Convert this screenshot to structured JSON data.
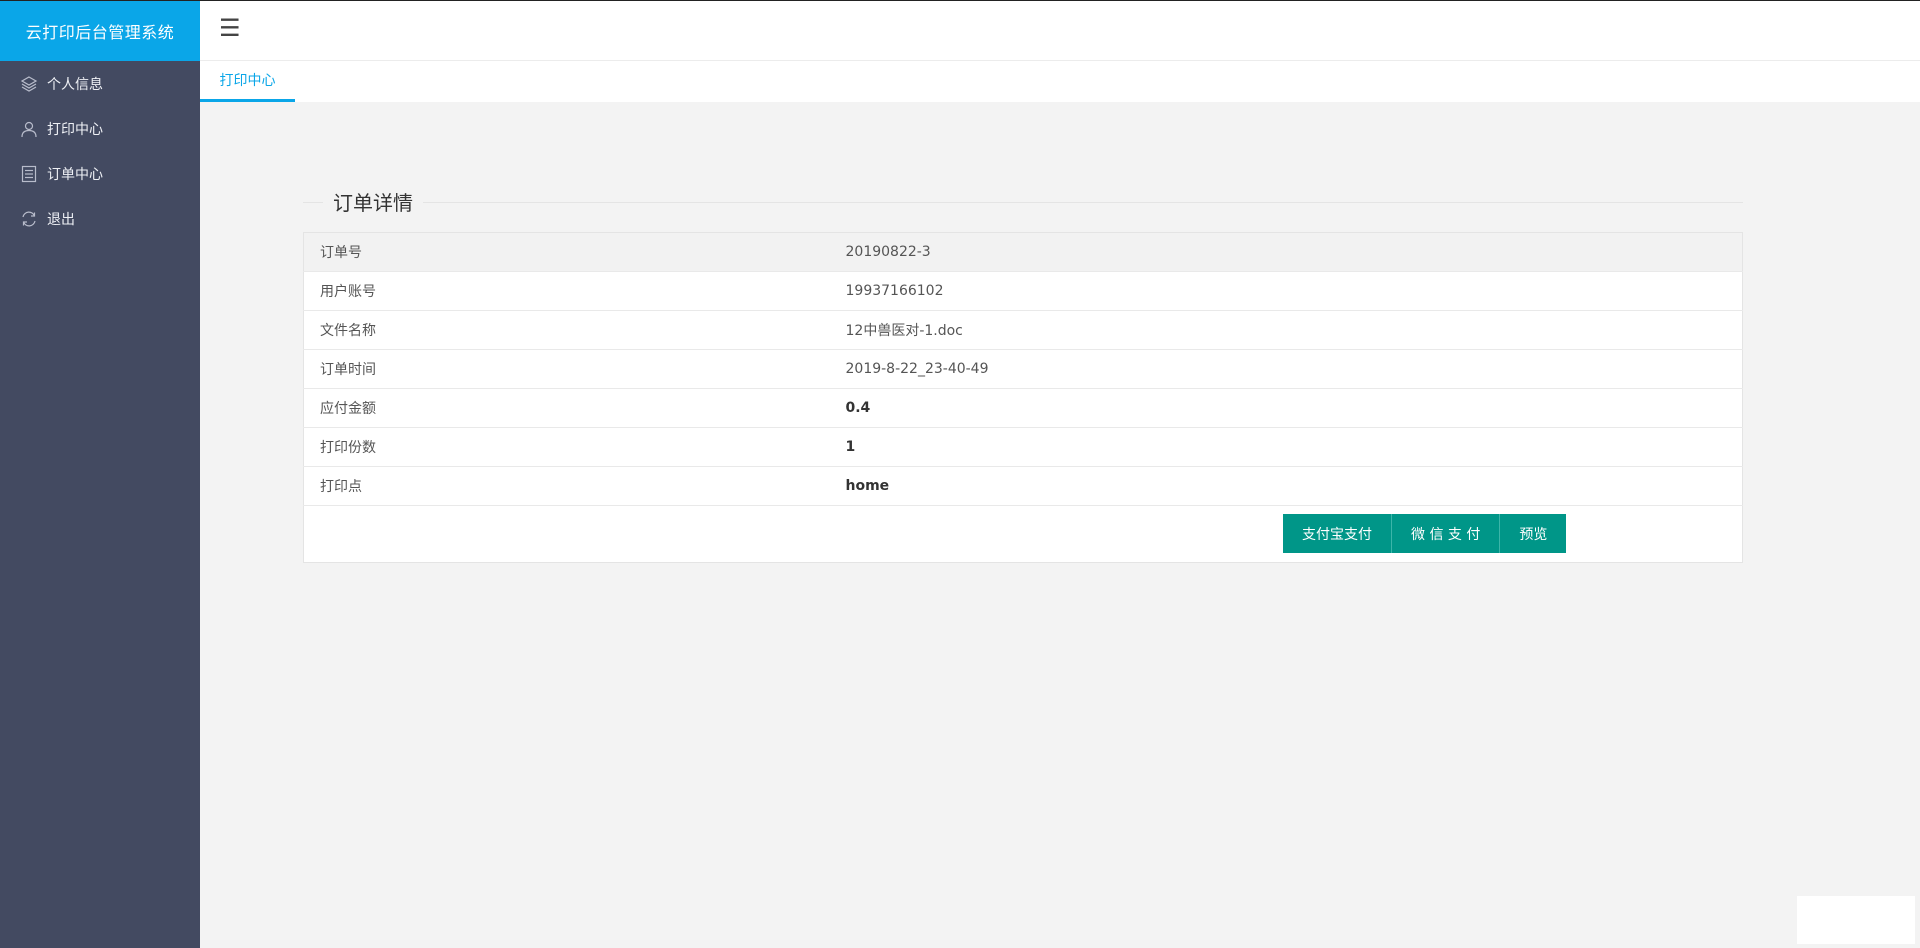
{
  "app": {
    "title": "云打印后台管理系统",
    "menu_icon": "☰"
  },
  "sidebar": {
    "items": [
      {
        "label": "个人信息",
        "icon": "layers-icon"
      },
      {
        "label": "打印中心",
        "icon": "user-icon"
      },
      {
        "label": "订单中心",
        "icon": "list-icon"
      },
      {
        "label": "退出",
        "icon": "refresh-icon"
      }
    ]
  },
  "tabs": [
    {
      "label": "打印中心",
      "active": true
    }
  ],
  "order": {
    "section_title": "订单详情",
    "rows": [
      {
        "label": "订单号",
        "value": "20190822-3"
      },
      {
        "label": "用户账号",
        "value": "19937166102"
      },
      {
        "label": "文件名称",
        "value": "12中兽医对-1.doc"
      },
      {
        "label": "订单时间",
        "value": "2019-8-22_23-40-49"
      },
      {
        "label": "应付金额",
        "value": "0.4"
      },
      {
        "label": "打印份数",
        "value": "1"
      },
      {
        "label": "打印点",
        "value": "home"
      }
    ],
    "buttons": {
      "alipay": "支付宝支付",
      "wechat": "微 信 支 付",
      "preview": "预览"
    }
  },
  "colors": {
    "brand": "#0aa6e8",
    "sidebar": "#434a61",
    "button": "#009688"
  }
}
